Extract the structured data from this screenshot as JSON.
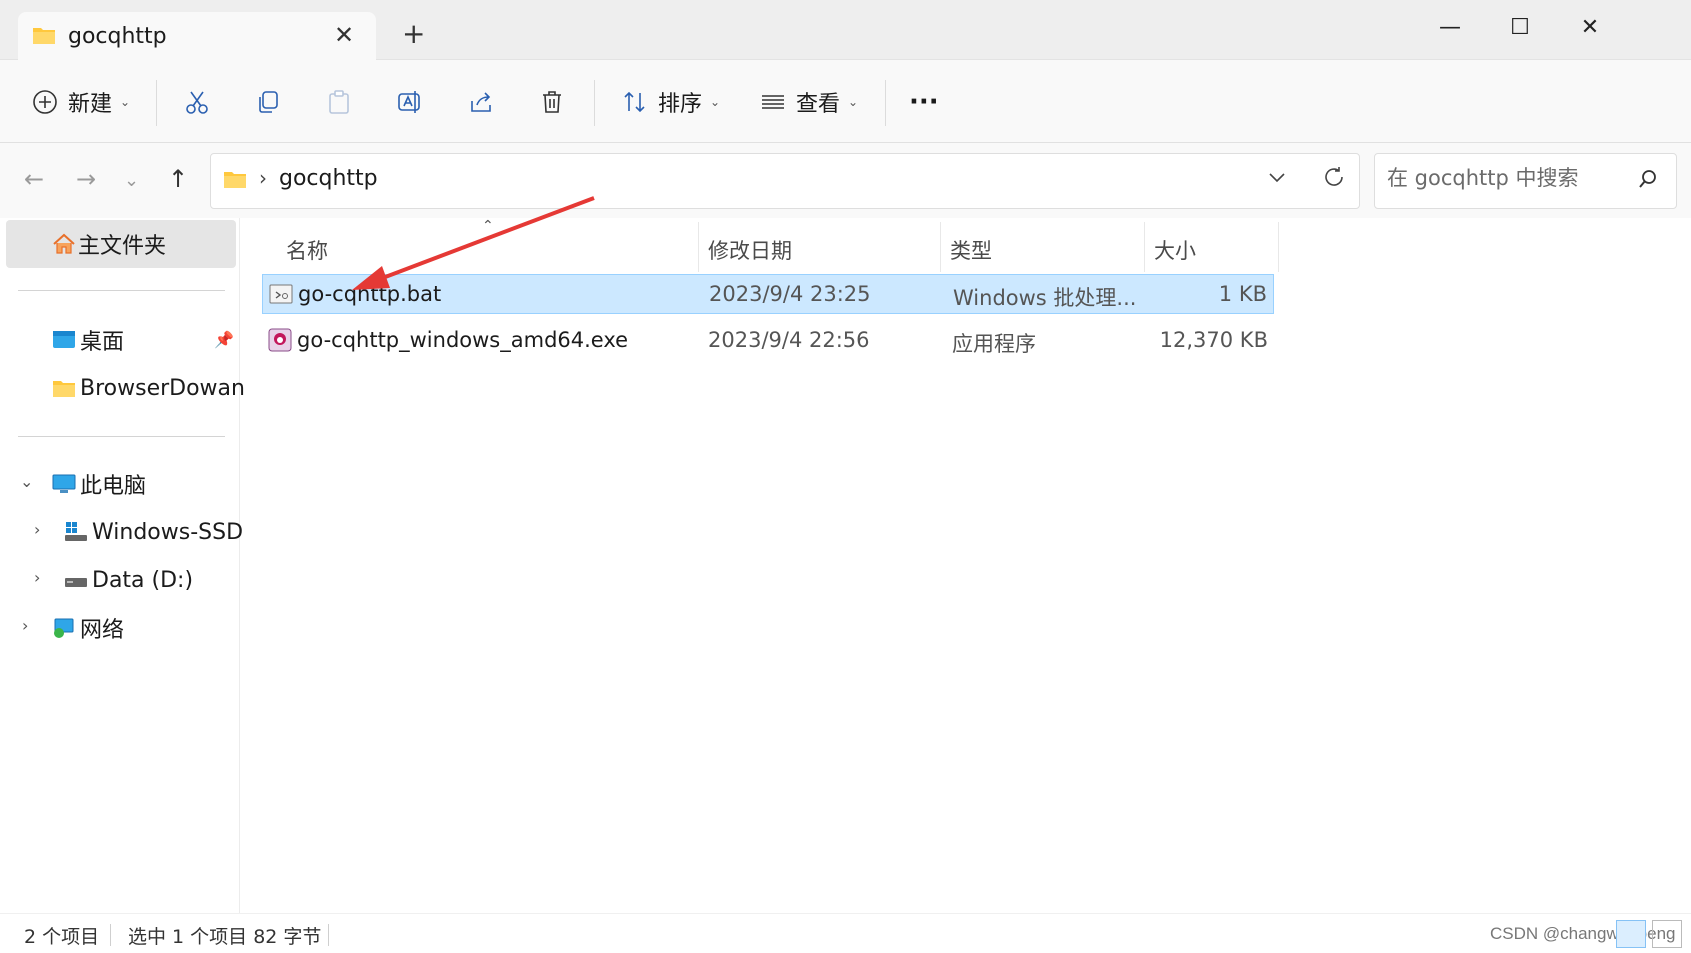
{
  "window": {
    "tab_title": "gocqhttp",
    "tab_close": "✕",
    "new_tab": "+",
    "minimize": "—",
    "maximize": "☐",
    "close": "✕"
  },
  "toolbar": {
    "new_label": "新建",
    "sort_label": "排序",
    "view_label": "查看",
    "more_label": "···"
  },
  "address": {
    "crumb": "gocqhttp",
    "separator": "›",
    "search_placeholder": "在 gocqhttp 中搜索"
  },
  "sidebar": {
    "home": "主文件夹",
    "desktop": "桌面",
    "browser": "BrowserDowan",
    "this_pc": "此电脑",
    "windows_ssd": "Windows-SSD",
    "data_d": "Data (D:)",
    "network": "网络"
  },
  "columns": {
    "name": "名称",
    "date": "修改日期",
    "type": "类型",
    "size": "大小"
  },
  "files": [
    {
      "name": "go-cqhttp.bat",
      "date": "2023/9/4 23:25",
      "type": "Windows 批处理...",
      "size": "1 KB",
      "selected": true,
      "icon": "batch-file-icon"
    },
    {
      "name": "go-cqhttp_windows_amd64.exe",
      "date": "2023/9/4 22:56",
      "type": "应用程序",
      "size": "12,370 KB",
      "selected": false,
      "icon": "exe-file-icon"
    }
  ],
  "status": {
    "count": "2 个项目",
    "selection": "选中 1 个项目  82 字节",
    "watermark": "CSDN @changwenpeng"
  },
  "colors": {
    "selection_bg": "#cce8ff",
    "selection_border": "#99d1ff",
    "annotation_arrow": "#e53935",
    "folder_yellow": "#ffc83d"
  }
}
